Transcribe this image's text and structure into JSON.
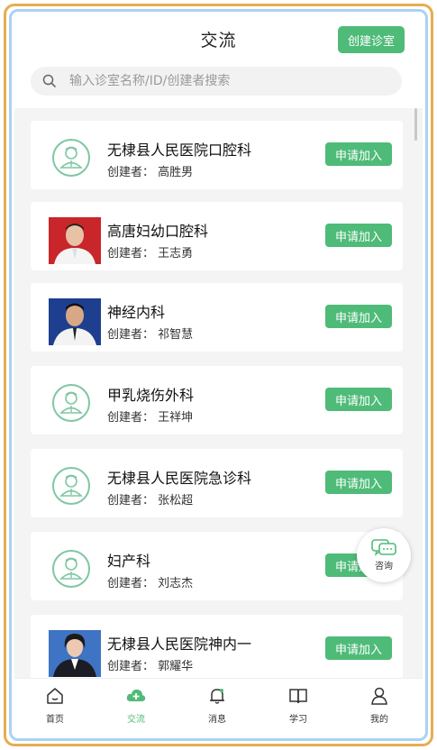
{
  "header": {
    "title": "交流",
    "create_button": "创建诊室"
  },
  "search": {
    "placeholder": "输入诊室名称/ID/创建者搜索"
  },
  "join_label": "申请加入",
  "clinics": [
    {
      "name": "无棣县人民医院口腔科",
      "creator": "创建者：   高胜男",
      "avatar": "default"
    },
    {
      "name": "高唐妇幼口腔科",
      "creator": "创建者：   王志勇",
      "avatar": "photo-red"
    },
    {
      "name": "神经内科",
      "creator": "创建者：   祁智慧",
      "avatar": "photo-blue"
    },
    {
      "name": "甲乳烧伤外科",
      "creator": "创建者：   王祥坤",
      "avatar": "default"
    },
    {
      "name": "无棣县人民医院急诊科",
      "creator": "创建者：   张松超",
      "avatar": "default"
    },
    {
      "name": "妇产科",
      "creator": "创建者：   刘志杰",
      "avatar": "default"
    },
    {
      "name": "无棣县人民医院神内一",
      "creator": "创建者：   郭耀华",
      "avatar": "photo-blue-woman"
    }
  ],
  "consult": {
    "label": "咨询",
    "icon": "chat-bubbles-icon"
  },
  "tabbar": [
    {
      "label": "首页",
      "icon": "home-icon",
      "active": false
    },
    {
      "label": "交流",
      "icon": "cloud-plus-icon",
      "active": true
    },
    {
      "label": "消息",
      "icon": "bell-icon",
      "active": false
    },
    {
      "label": "学习",
      "icon": "book-icon",
      "active": false
    },
    {
      "label": "我的",
      "icon": "person-icon",
      "active": false
    }
  ],
  "colors": {
    "accent": "#4fbb78",
    "frame_gold": "#e6ad4f",
    "frame_blue": "#a9d3f2"
  }
}
